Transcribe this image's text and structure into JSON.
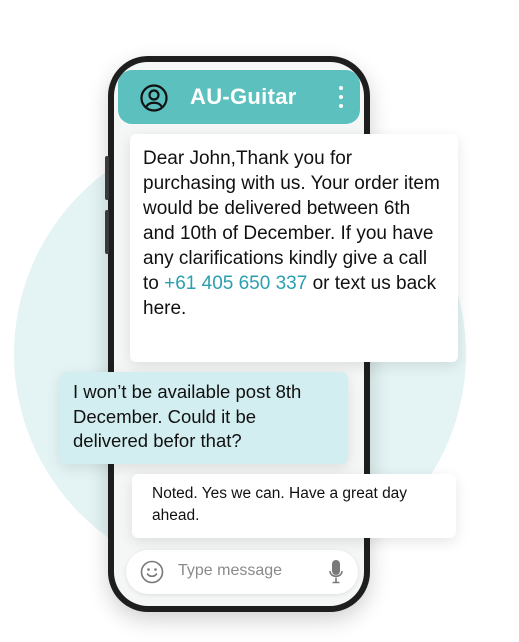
{
  "colors": {
    "header_bg": "#5bc0be",
    "outgoing_bubble_bg": "#d3eef0",
    "incoming_bubble_bg": "#ffffff",
    "link_color": "#2a9faf",
    "background_circle": "#e4f4f4",
    "phone_frame": "#1e1e1e"
  },
  "header": {
    "title": "AU-Guitar",
    "avatar_icon": "user-circle-icon",
    "menu_icon": "kebab-menu-icon"
  },
  "messages": [
    {
      "direction": "incoming",
      "text_before_link": "Dear John,Thank you for purchasing with us. Your order item would be delivered between 6th and 10th of December. If you have any clarifications kindly give a call to ",
      "link": "+61 405 650 337",
      "text_after_link": " or text us back here."
    },
    {
      "direction": "outgoing",
      "text": "I won’t be available post 8th December. Could it be delivered befor that?"
    },
    {
      "direction": "incoming",
      "text": "Noted. Yes we can. Have a great day ahead."
    }
  ],
  "composer": {
    "placeholder": "Type message",
    "emoji_icon": "smile-icon",
    "mic_icon": "microphone-icon"
  }
}
